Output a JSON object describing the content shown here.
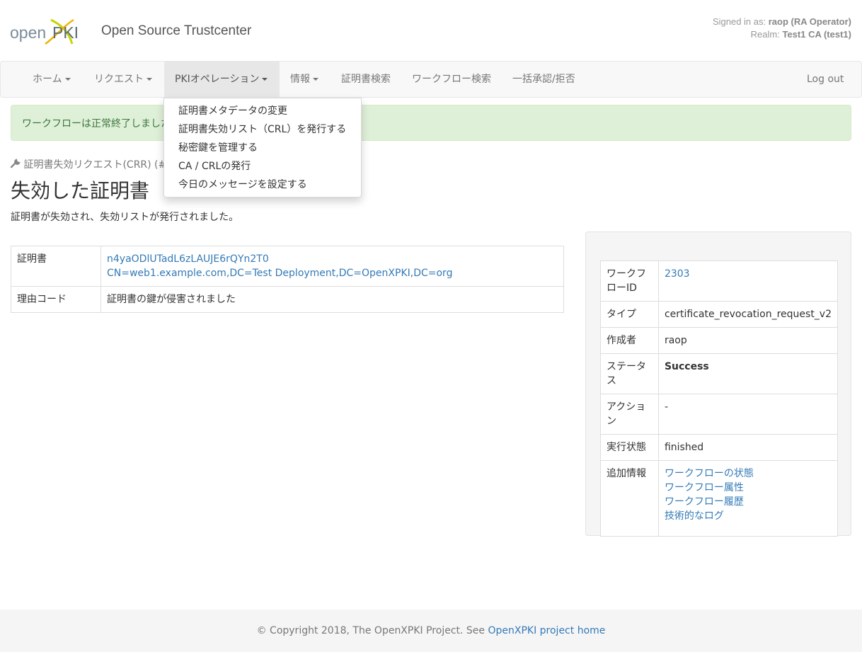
{
  "header": {
    "logo_text": "openXPKI",
    "title": "Open Source Trustcenter",
    "signed_in_label": "Signed in as:",
    "signed_in_user": "raop (RA Operator)",
    "realm_label": "Realm:",
    "realm_value": "Test1 CA (test1)"
  },
  "nav": {
    "items": [
      {
        "label": "ホーム"
      },
      {
        "label": "リクエスト"
      },
      {
        "label": "PKIオペレーション"
      },
      {
        "label": "情報"
      },
      {
        "label": "証明書検索"
      },
      {
        "label": "ワークフロー検索"
      },
      {
        "label": "一括承認/拒否"
      }
    ],
    "logout": "Log out"
  },
  "dropdown": {
    "items": [
      {
        "label": "証明書メタデータの変更"
      },
      {
        "label": "証明書失効リスト（CRL）を発行する"
      },
      {
        "label": "秘密鍵を管理する"
      },
      {
        "label": "CA / CRLの発行"
      },
      {
        "label": "今日のメッセージを設定する"
      }
    ]
  },
  "alert": {
    "text": "ワークフローは正常終了しました"
  },
  "breadcrumb": "証明書失効リクエスト(CRR) (#2303)",
  "page": {
    "title": "失効した証明書",
    "description": "証明書が失効され、失効リストが発行されました。"
  },
  "main_table": {
    "rows": [
      {
        "key": "証明書",
        "value_line1": "n4yaODlUTadL6zLAUJE6rQYn2T0",
        "value_line2": "CN=web1.example.com,DC=Test Deployment,DC=OpenXPKI,DC=org"
      },
      {
        "key": "理由コード",
        "value": "証明書の鍵が侵害されました"
      }
    ]
  },
  "side": {
    "rows": [
      {
        "key": "ワークフローID",
        "value": "2303"
      },
      {
        "key": "タイプ",
        "value": "certificate_revocation_request_v2"
      },
      {
        "key": "作成者",
        "value": "raop"
      },
      {
        "key": "ステータス",
        "value": "Success"
      },
      {
        "key": "アクション",
        "value": "-"
      },
      {
        "key": "実行状態",
        "value": "finished"
      },
      {
        "key": "追加情報",
        "links": [
          "ワークフローの状態",
          "ワークフロー属性",
          "ワークフロー履歴",
          "技術的なログ"
        ]
      }
    ]
  },
  "footer": {
    "text": "© Copyright 2018, The OpenXPKI Project. See ",
    "link": "OpenXPKI project home"
  }
}
